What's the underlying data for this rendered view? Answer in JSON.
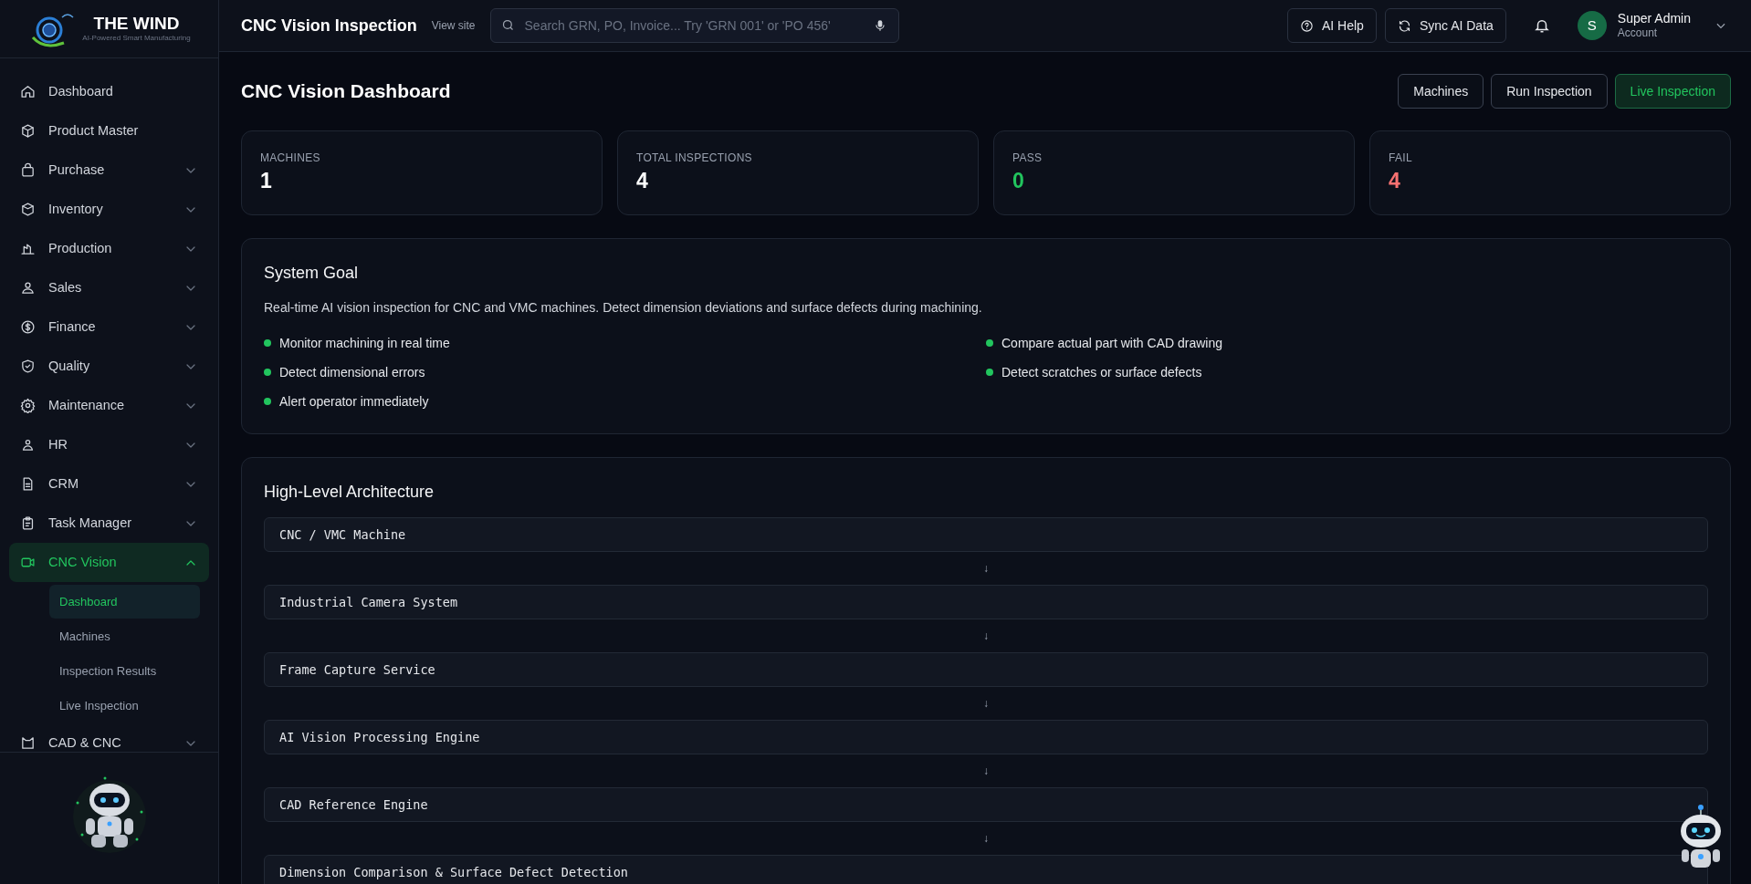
{
  "logo": {
    "name": "THE WIND",
    "tagline": "AI-Powered Smart Manufacturing"
  },
  "sidebar": {
    "items": [
      {
        "label": "Dashboard",
        "selected": false
      },
      {
        "label": "Product Master",
        "selected": false
      },
      {
        "label": "Purchase",
        "expanded": false,
        "selected": false
      },
      {
        "label": "Inventory",
        "expanded": false,
        "selected": false
      },
      {
        "label": "Production",
        "expanded": false,
        "selected": false
      },
      {
        "label": "Sales",
        "expanded": false,
        "selected": false
      },
      {
        "label": "Finance",
        "expanded": false,
        "selected": false
      },
      {
        "label": "Quality",
        "expanded": false,
        "selected": false
      },
      {
        "label": "Maintenance",
        "expanded": false,
        "selected": false
      },
      {
        "label": "HR",
        "expanded": false,
        "selected": false
      },
      {
        "label": "CRM",
        "expanded": false,
        "selected": false
      },
      {
        "label": "Task Manager",
        "expanded": false,
        "selected": false
      },
      {
        "label": "CNC Vision",
        "expanded": true,
        "selected": true,
        "children": [
          {
            "label": "Dashboard",
            "selected": true
          },
          {
            "label": "Machines",
            "selected": false
          },
          {
            "label": "Inspection Results",
            "selected": false
          },
          {
            "label": "Live Inspection",
            "selected": false
          }
        ]
      },
      {
        "label": "CAD & CNC",
        "expanded": false,
        "selected": false
      }
    ]
  },
  "header": {
    "title": "CNC Vision Inspection",
    "view_site": "View site",
    "search": {
      "placeholder": "Search GRN, PO, Invoice... Try 'GRN 001' or 'PO 456'"
    },
    "buttons": [
      "AI Help",
      "Sync AI Data"
    ],
    "user": {
      "initial": "S",
      "name": "Super Admin",
      "role": "Account"
    }
  },
  "page": {
    "title": "CNC Vision Dashboard",
    "actions": [
      {
        "label": "Machines",
        "kind": "outline"
      },
      {
        "label": "Run Inspection",
        "kind": "outline"
      },
      {
        "label": "Live Inspection",
        "kind": "primary"
      }
    ],
    "stats": [
      {
        "label": "MACHINES",
        "value": "1",
        "color": "#ffffff"
      },
      {
        "label": "TOTAL INSPECTIONS",
        "value": "4",
        "color": "#ffffff"
      },
      {
        "label": "PASS",
        "value": "0",
        "color": "#22c55e"
      },
      {
        "label": "FAIL",
        "value": "4",
        "color": "#f87171"
      }
    ],
    "system_goal": {
      "title": "System Goal",
      "description": "Real-time AI vision inspection for CNC and VMC machines. Detect dimension deviations and surface defects during machining.",
      "points": [
        "Monitor machining in real time",
        "Detect dimensional errors",
        "Alert operator immediately",
        "Compare actual part with CAD drawing",
        "Detect scratches or surface defects"
      ]
    },
    "architecture": {
      "title": "High-Level Architecture",
      "steps": [
        {
          "label": "CNC / VMC Machine",
          "arrow": "↓"
        },
        {
          "label": "Industrial Camera System",
          "arrow": "↓"
        },
        {
          "label": "Frame Capture Service",
          "arrow": "↓"
        },
        {
          "label": "AI Vision Processing Engine",
          "arrow": "↓"
        },
        {
          "label": "CAD Reference Engine",
          "arrow": "↓"
        },
        {
          "label": "Dimension Comparison & Surface Defect Detection"
        }
      ]
    }
  }
}
